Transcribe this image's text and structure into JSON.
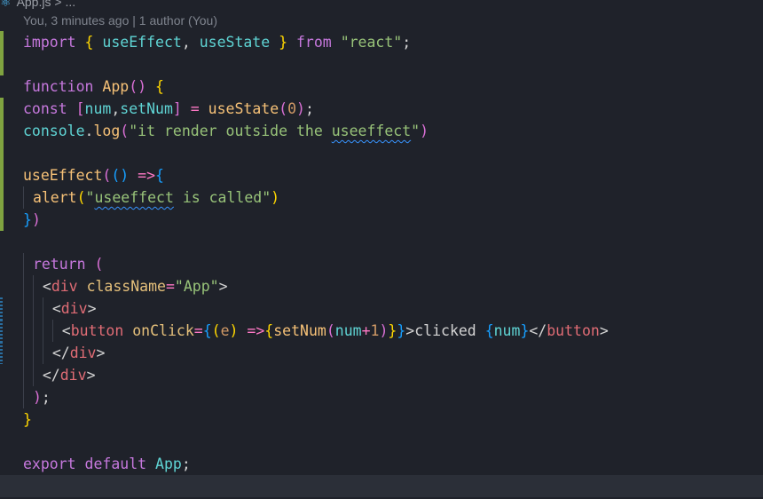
{
  "breadcrumb": {
    "file": "App.js",
    "trail": "> ..."
  },
  "blame": "You, 3 minutes ago | 1 author (You)",
  "code": {
    "l1": {
      "import": "import",
      "ob": "{",
      "useEffect": "useEffect",
      "comma": ",",
      "useState": "useState",
      "cb": "}",
      "from": "from",
      "src": "\"react\"",
      "semi": ";"
    },
    "l3": {
      "function": "function",
      "name": "App",
      "parens": "()",
      "ob": "{"
    },
    "l4": {
      "const": "const",
      "ob": "[",
      "num": "num",
      "comma": ",",
      "setNum": "setNum",
      "cb": "]",
      "eq": "=",
      "call": "useState",
      "op": "(",
      "zero": "0",
      "cp": ")",
      "semi": ";"
    },
    "l5": {
      "console": "console",
      "dot": ".",
      "log": "log",
      "op": "(",
      "str_a": "\"it render outside the ",
      "str_b": "useeffect",
      "str_c": "\"",
      "cp": ")"
    },
    "l7": {
      "call": "useEffect",
      "op": "(",
      "args": "()",
      "arrow": "=>",
      "ob": "{"
    },
    "l8": {
      "alert": "alert",
      "op": "(",
      "str_a": "\"",
      "str_b": "useeffect",
      "str_c": " is called\"",
      "cp": ")"
    },
    "l9": {
      "cb": "}",
      "cp": ")"
    },
    "l11": {
      "return": "return",
      "op": "("
    },
    "l12": {
      "lt": "<",
      "tag": "div",
      "attr": "className",
      "eq": "=",
      "val": "\"App\"",
      "gt": ">"
    },
    "l13": {
      "lt": "<",
      "tag": "div",
      "gt": ">"
    },
    "l14": {
      "lt": "<",
      "tag": "button",
      "attr": "onClick",
      "eq": "=",
      "ob": "{",
      "op": "(",
      "e": "e",
      "cp": ")",
      "arrow": "=>",
      "ob2": "{",
      "call": "setNum",
      "op2": "(",
      "arg": "num",
      "plus": "+",
      "one": "1",
      "cp2": ")",
      "cb2": "}",
      "cb": "}",
      "gt": ">",
      "text": "clicked ",
      "ob3": "{",
      "num": "num",
      "cb3": "}",
      "close_lt": "</",
      "close_tag": "button",
      "close_gt": ">"
    },
    "l15": {
      "lt": "</",
      "tag": "div",
      "gt": ">"
    },
    "l16": {
      "lt": "</",
      "tag": "div",
      "gt": ">"
    },
    "l17": {
      "cp": ")",
      "semi": ";"
    },
    "l18": {
      "cb": "}"
    },
    "l20": {
      "export": "export",
      "default": "default",
      "name": "App",
      "semi": ";"
    }
  }
}
